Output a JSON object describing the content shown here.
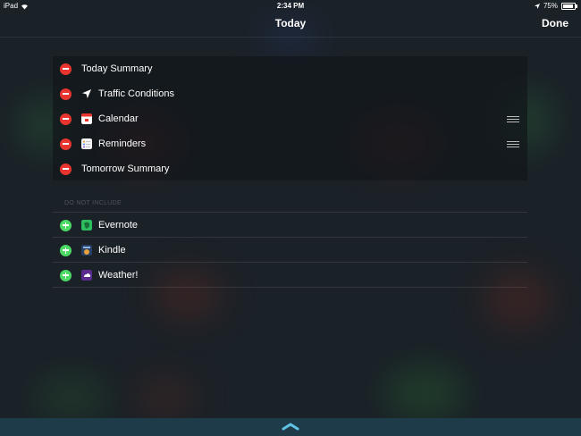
{
  "status_bar": {
    "device": "iPad",
    "time": "2:34 PM",
    "battery": "75%"
  },
  "nav": {
    "title": "Today",
    "done_label": "Done"
  },
  "included": [
    {
      "label": "Today Summary",
      "icon": "none",
      "reorder": false
    },
    {
      "label": "Traffic Conditions",
      "icon": "location-arrow-icon",
      "reorder": false
    },
    {
      "label": "Calendar",
      "icon": "calendar-app-icon",
      "reorder": true
    },
    {
      "label": "Reminders",
      "icon": "reminders-app-icon",
      "reorder": true
    },
    {
      "label": "Tomorrow Summary",
      "icon": "none",
      "reorder": false
    }
  ],
  "excluded_header": "DO NOT INCLUDE",
  "excluded": [
    {
      "label": "Evernote",
      "icon": "evernote-app-icon"
    },
    {
      "label": "Kindle",
      "icon": "kindle-app-icon"
    },
    {
      "label": "Weather!",
      "icon": "weather-app-icon"
    }
  ],
  "colors": {
    "remove": "#e8352f",
    "add": "#4cd964",
    "bottom_bar": "#1e3b49"
  }
}
